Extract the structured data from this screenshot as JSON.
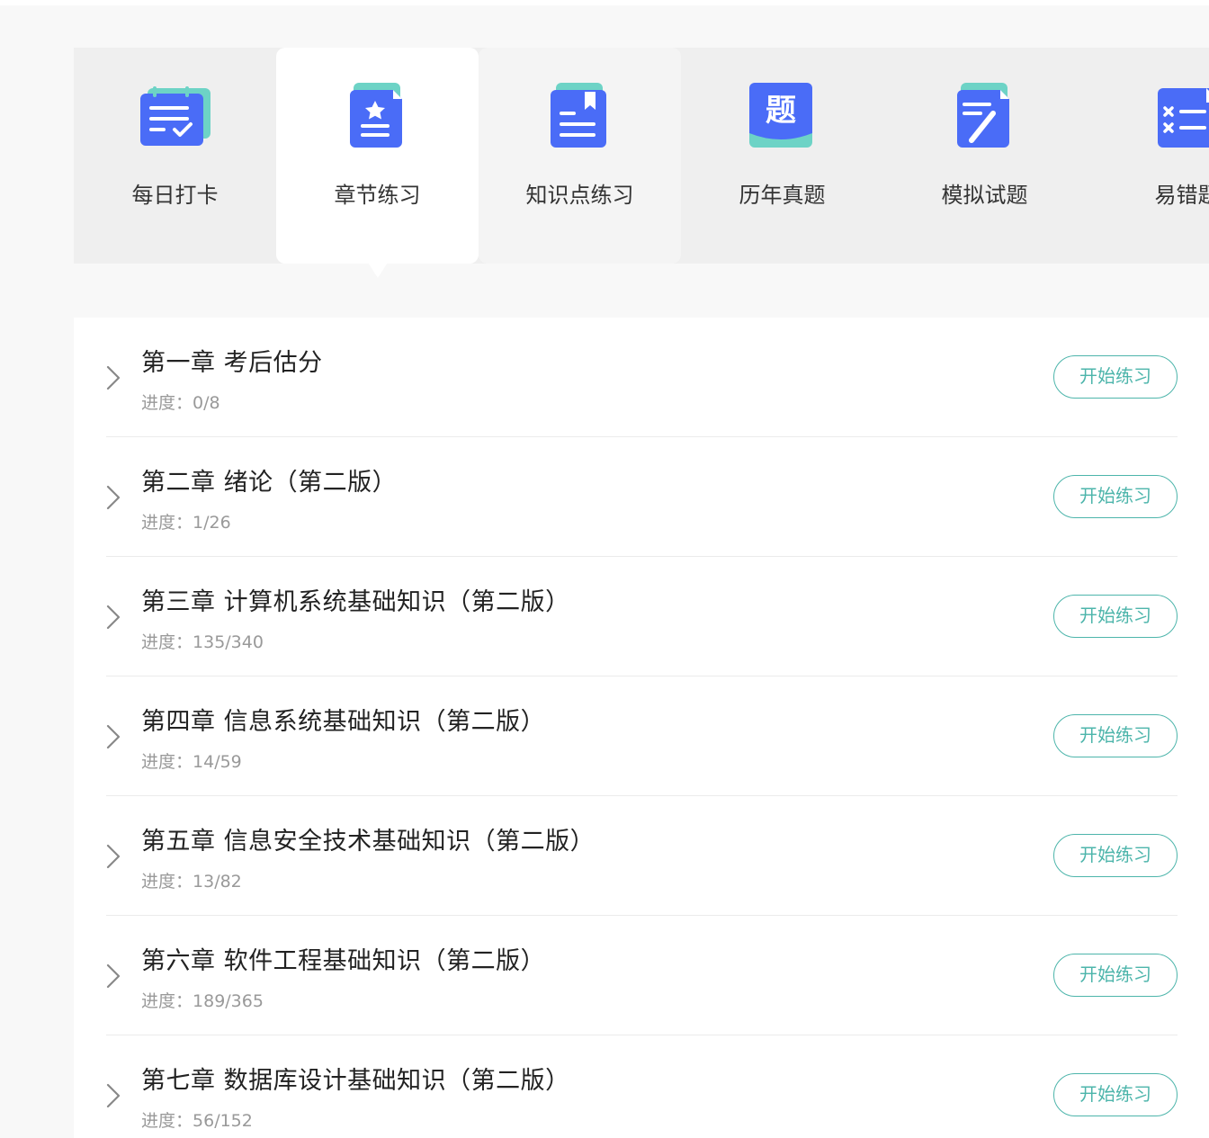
{
  "colors": {
    "accent_teal": "#4db5ab",
    "icon_blue": "#4a6cf7",
    "icon_teal": "#6dd3c6",
    "tabbar_bg": "#efefef",
    "page_bg": "#f8f8f8"
  },
  "tabs": [
    {
      "label": "每日打卡",
      "icon": "calendar-check-icon",
      "state": "normal"
    },
    {
      "label": "章节练习",
      "icon": "chapter-star-doc-icon",
      "state": "active"
    },
    {
      "label": "知识点练习",
      "icon": "bookmark-doc-icon",
      "state": "hover"
    },
    {
      "label": "历年真题",
      "icon": "past-exam-icon",
      "glyph": "题",
      "state": "normal"
    },
    {
      "label": "模拟试题",
      "icon": "pen-doc-icon",
      "state": "normal"
    },
    {
      "label": "易错题",
      "icon": "wrong-list-icon",
      "state": "normal"
    }
  ],
  "chapters": [
    {
      "title": "第一章  考后估分",
      "progress_label": "进度：",
      "progress": "0/8",
      "button": "开始练习"
    },
    {
      "title": "第二章  绪论（第二版）",
      "progress_label": "进度：",
      "progress": "1/26",
      "button": "开始练习"
    },
    {
      "title": "第三章  计算机系统基础知识（第二版）",
      "progress_label": "进度：",
      "progress": "135/340",
      "button": "开始练习"
    },
    {
      "title": "第四章  信息系统基础知识（第二版）",
      "progress_label": "进度：",
      "progress": "14/59",
      "button": "开始练习"
    },
    {
      "title": "第五章  信息安全技术基础知识（第二版）",
      "progress_label": "进度：",
      "progress": "13/82",
      "button": "开始练习"
    },
    {
      "title": "第六章  软件工程基础知识（第二版）",
      "progress_label": "进度：",
      "progress": "189/365",
      "button": "开始练习"
    },
    {
      "title": "第七章  数据库设计基础知识（第二版）",
      "progress_label": "进度：",
      "progress": "56/152",
      "button": "开始练习"
    }
  ]
}
